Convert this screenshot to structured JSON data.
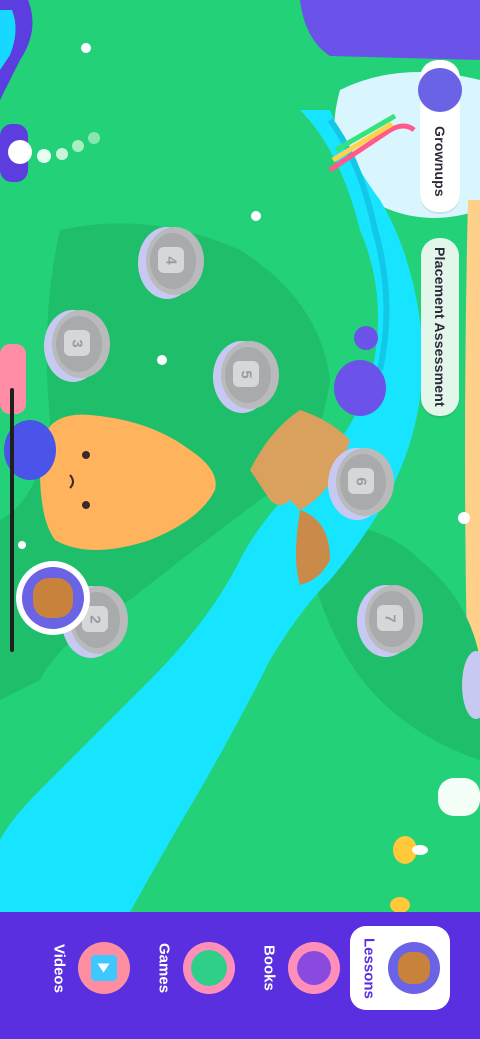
{
  "header": {
    "grownups_label": "Grownups",
    "placement_label": "Placement Assessment"
  },
  "levels": [
    {
      "label": "2"
    },
    {
      "label": "3"
    },
    {
      "label": "4"
    },
    {
      "label": "5"
    },
    {
      "label": "6"
    },
    {
      "label": "7"
    }
  ],
  "nav": {
    "items": [
      {
        "label": "Lessons",
        "icon": "owl-mascot-icon",
        "active": true
      },
      {
        "label": "Books",
        "icon": "cat-reader-icon",
        "active": false
      },
      {
        "label": "Games",
        "icon": "green-monster-icon",
        "active": false
      },
      {
        "label": "Videos",
        "icon": "video-play-icon",
        "active": false
      }
    ]
  },
  "colors": {
    "grass": "#23d178",
    "river": "#18e6ff",
    "nav": "#5a2fe0",
    "node": "#b9babb"
  }
}
